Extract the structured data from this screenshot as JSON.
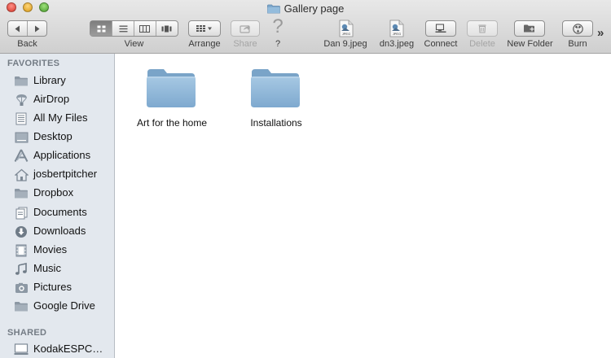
{
  "window": {
    "title": "Gallery page"
  },
  "toolbar": {
    "back_label": "Back",
    "view_label": "View",
    "arrange_label": "Arrange",
    "share_label": "Share",
    "help_label": "?",
    "help_glyph": "?",
    "file1_label": "Dan 9.jpeg",
    "file2_label": "dn3.jpeg",
    "connect_label": "Connect",
    "delete_label": "Delete",
    "newfolder_label": "New Folder",
    "burn_label": "Burn",
    "overflow_glyph": "»",
    "jpeg_badge": "JPEG"
  },
  "sidebar": {
    "favorites_header": "FAVORITES",
    "shared_header": "SHARED",
    "items": [
      {
        "label": "Library",
        "icon": "folder-icon"
      },
      {
        "label": "AirDrop",
        "icon": "airdrop-icon"
      },
      {
        "label": "All My Files",
        "icon": "all-files-icon"
      },
      {
        "label": "Desktop",
        "icon": "desktop-icon"
      },
      {
        "label": "Applications",
        "icon": "applications-icon"
      },
      {
        "label": "josbertpitcher",
        "icon": "home-icon"
      },
      {
        "label": "Dropbox",
        "icon": "folder-icon"
      },
      {
        "label": "Documents",
        "icon": "documents-icon"
      },
      {
        "label": "Downloads",
        "icon": "downloads-icon"
      },
      {
        "label": "Movies",
        "icon": "movies-icon"
      },
      {
        "label": "Music",
        "icon": "music-icon"
      },
      {
        "label": "Pictures",
        "icon": "pictures-icon"
      },
      {
        "label": "Google Drive",
        "icon": "folder-icon"
      }
    ],
    "shared": [
      {
        "label": "KodakESPC…",
        "icon": "computer-icon"
      }
    ]
  },
  "content": {
    "items": [
      {
        "label": "Art for the home",
        "icon": "folder-icon"
      },
      {
        "label": "Installations",
        "icon": "folder-icon"
      }
    ]
  },
  "colors": {
    "folder_blue": "#8fb6d6",
    "sidebar_bg": "#e3e8ee",
    "sidebar_header": "#747c85"
  }
}
